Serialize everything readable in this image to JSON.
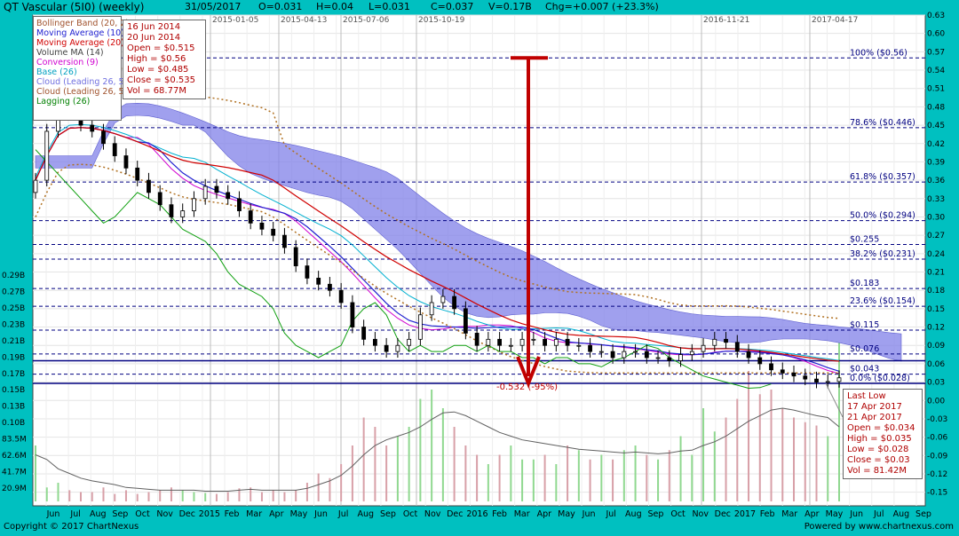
{
  "header": {
    "title": "QT Vascular (5I0) (weekly)",
    "date": "31/05/2017",
    "open": "O=0.031",
    "high": "H=0.04",
    "low": "L=0.031",
    "close": "C=0.037",
    "volume": "V=0.17B",
    "change": "Chg=+0.007 (+23.3%)"
  },
  "footer": {
    "copyright": "Copyright © 2017 ChartNexus",
    "powered": "Powered by www.chartnexus.com"
  },
  "legend": [
    {
      "label": "Bollinger Band (20, 2)",
      "color": "#a0522d"
    },
    {
      "label": "Moving Average (10)",
      "color": "#2020d0"
    },
    {
      "label": "Moving Average (20)",
      "color": "#d00000"
    },
    {
      "label": "Volume MA (14)",
      "color": "#404040"
    },
    {
      "label": "Conversion (9)",
      "color": "#d000d0"
    },
    {
      "label": "Base (26)",
      "color": "#00a0c0"
    },
    {
      "label": "Cloud (Leading 26, 5",
      "color": "#7070e0"
    },
    {
      "label": "Cloud (Leading 26, 5",
      "color": "#a0522d"
    },
    {
      "label": "Lagging (26)",
      "color": "#008000"
    }
  ],
  "first_info": [
    "16 Jun 2014",
    "20 Jun 2014",
    "Open = $0.515",
    "High = $0.56",
    "Low   = $0.485",
    "Close = $0.535",
    "Vol   = 68.77M"
  ],
  "last_info": [
    "Last Low",
    "17 Apr 2017",
    "21 Apr 2017",
    "Open = $0.034",
    "High = $0.035",
    "Low   = $0.028",
    "Close = $0.03",
    "Vol   = 81.42M"
  ],
  "decline_label": "-0.532 (-95%)",
  "colors": {
    "background": "#00c0c0",
    "plot": "#ffffff",
    "fib_line": "#000080",
    "arrow": "#c00000",
    "cloud": "#8080e8",
    "bollinger": "#b07020",
    "lagging": "#10a010",
    "vol_up": "#90d890",
    "vol_down": "#d8a0a8"
  },
  "chart_data": {
    "type": "candlestick",
    "title": "QT Vascular (5I0) (weekly)",
    "price_axis": {
      "labels": [
        "0.63",
        "0.60",
        "0.57",
        "0.54",
        "0.51",
        "0.48",
        "0.45",
        "0.42",
        "0.39",
        "0.36",
        "0.33",
        "0.30",
        "0.27",
        "0.24",
        "0.21",
        "0.18",
        "0.15",
        "0.12",
        "0.09",
        "0.06",
        "0.03",
        "0.00",
        "-0.03",
        "-0.06",
        "-0.09",
        "-0.12",
        "-0.15"
      ],
      "range": [
        -0.165,
        0.63
      ]
    },
    "volume_axis": {
      "labels": [
        "0.29B",
        "0.27B",
        "0.25B",
        "0.23B",
        "0.21B",
        "0.19B",
        "0.17B",
        "0.15B",
        "0.13B",
        "0.10B",
        "83.5M",
        "62.6M",
        "41.7M",
        "20.9M"
      ]
    },
    "time_axis": [
      "Jun",
      "Jul",
      "Aug",
      "Sep",
      "Oct",
      "Nov",
      "Dec",
      "2015",
      "Feb",
      "Mar",
      "Apr",
      "May",
      "Jun",
      "Jul",
      "Aug",
      "Sep",
      "Oct",
      "Nov",
      "Dec",
      "2016",
      "Feb",
      "Mar",
      "Apr",
      "May",
      "Jun",
      "Jul",
      "Aug",
      "Sep",
      "Oct",
      "Nov",
      "Dec",
      "2017",
      "Feb",
      "Mar",
      "Apr",
      "May",
      "Jun",
      "Jul",
      "Aug",
      "Sep"
    ],
    "top_dates": [
      "2015-01-05",
      "2015-04-13",
      "2015-07-06",
      "2015-10-19",
      "2016-11-21",
      "2017-04-17"
    ],
    "fibonacci": [
      {
        "label": "100%",
        "value": 0.56,
        "text": "($0.56)"
      },
      {
        "label": "78.6%",
        "value": 0.446,
        "text": "($0.446)"
      },
      {
        "label": "61.8%",
        "value": 0.357,
        "text": "($0.357)"
      },
      {
        "label": "50.0%",
        "value": 0.294,
        "text": "($0.294)"
      },
      {
        "label": "",
        "value": 0.255,
        "text": "$0.255"
      },
      {
        "label": "38.2%",
        "value": 0.231,
        "text": "($0.231)"
      },
      {
        "label": "",
        "value": 0.183,
        "text": "$0.183"
      },
      {
        "label": "23.6%",
        "value": 0.154,
        "text": "($0.154)"
      },
      {
        "label": "",
        "value": 0.115,
        "text": "$0.115"
      },
      {
        "label": "",
        "value": 0.076,
        "text": "$0.076"
      },
      {
        "label": "",
        "value": 0.043,
        "text": "$0.043"
      },
      {
        "label": "0.0%",
        "value": 0.028,
        "text": "($0.028)"
      }
    ],
    "decline": {
      "from": 0.56,
      "to": 0.028,
      "change": -0.532,
      "pct": -95
    },
    "closes": [
      0.36,
      0.44,
      0.5,
      0.48,
      0.45,
      0.44,
      0.42,
      0.4,
      0.38,
      0.36,
      0.34,
      0.32,
      0.3,
      0.31,
      0.33,
      0.35,
      0.34,
      0.33,
      0.31,
      0.29,
      0.28,
      0.27,
      0.25,
      0.22,
      0.2,
      0.19,
      0.18,
      0.16,
      0.12,
      0.1,
      0.09,
      0.08,
      0.09,
      0.1,
      0.14,
      0.16,
      0.17,
      0.15,
      0.11,
      0.09,
      0.1,
      0.09,
      0.09,
      0.1,
      0.1,
      0.09,
      0.1,
      0.09,
      0.09,
      0.08,
      0.08,
      0.07,
      0.08,
      0.08,
      0.07,
      0.07,
      0.065,
      0.075,
      0.08,
      0.09,
      0.1,
      0.095,
      0.08,
      0.07,
      0.06,
      0.05,
      0.045,
      0.04,
      0.035,
      0.03,
      0.031,
      0.037
    ],
    "volume_m": [
      60,
      15,
      20,
      12,
      10,
      10,
      15,
      8,
      12,
      8,
      10,
      12,
      15,
      12,
      10,
      9,
      8,
      10,
      14,
      15,
      10,
      12,
      10,
      12,
      20,
      30,
      25,
      40,
      60,
      90,
      80,
      60,
      70,
      80,
      110,
      120,
      100,
      80,
      60,
      50,
      40,
      50,
      60,
      45,
      45,
      50,
      40,
      60,
      55,
      45,
      50,
      45,
      55,
      60,
      50,
      45,
      55,
      70,
      50,
      100,
      75,
      90,
      110,
      140,
      115,
      120,
      100,
      90,
      85,
      81.42,
      70,
      170
    ],
    "volume_ma_m": [
      50,
      45,
      35,
      30,
      25,
      22,
      20,
      18,
      15,
      14,
      13,
      12,
      12,
      12,
      12,
      11,
      11,
      11,
      12,
      13,
      12,
      12,
      12,
      12,
      14,
      18,
      22,
      28,
      38,
      50,
      60,
      66,
      70,
      74,
      80,
      88,
      95,
      96,
      92,
      86,
      80,
      74,
      70,
      66,
      64,
      62,
      60,
      58,
      56,
      55,
      54,
      53,
      52,
      53,
      52,
      51,
      52,
      54,
      55,
      60,
      64,
      70,
      78,
      86,
      92,
      98,
      100,
      98,
      95,
      92,
      90,
      80
    ]
  }
}
